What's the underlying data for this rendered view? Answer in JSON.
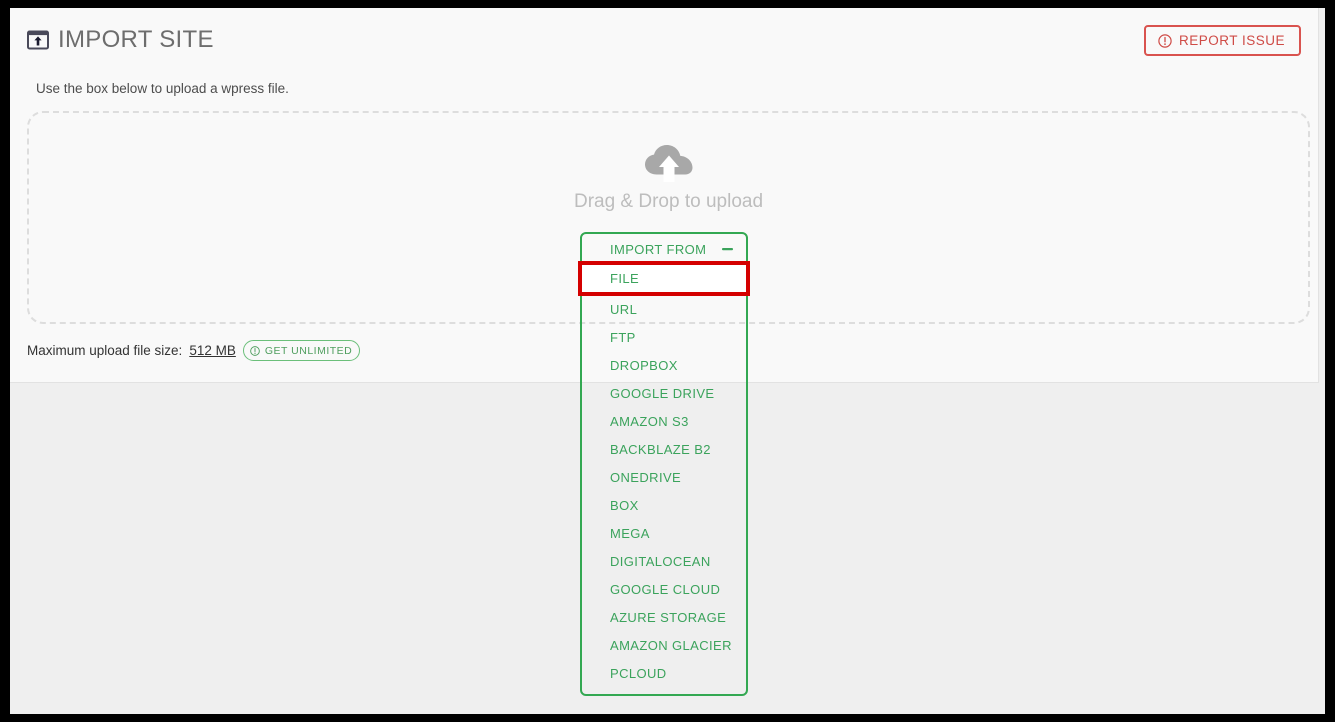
{
  "header": {
    "title": "IMPORT SITE",
    "title_icon": "import-site-icon",
    "report_issue_label": "REPORT ISSUE",
    "report_issue_icon": "exclamation-circle-icon",
    "report_issue_color": "#d9534f"
  },
  "card": {
    "subtitle": "Use the box below to upload a wpress file."
  },
  "dropzone": {
    "icon": "upload-cloud-icon",
    "label": "Drag & Drop to upload",
    "border_color": "#dddddd"
  },
  "maxsize": {
    "label": "Maximum upload file size:",
    "value": "512 MB",
    "get_unlimited_label": "GET UNLIMITED",
    "get_unlimited_icon": "exclamation-circle-icon",
    "get_unlimited_color": "#6bbf7a"
  },
  "import_menu": {
    "header_label": "IMPORT FROM",
    "collapse_icon": "minus-icon",
    "accent_color": "#33a852",
    "highlight_color": "#d40000",
    "selected": "FILE",
    "items": [
      {
        "label": "FILE"
      },
      {
        "label": "URL"
      },
      {
        "label": "FTP"
      },
      {
        "label": "DROPBOX"
      },
      {
        "label": "GOOGLE DRIVE"
      },
      {
        "label": "AMAZON S3"
      },
      {
        "label": "BACKBLAZE B2"
      },
      {
        "label": "ONEDRIVE"
      },
      {
        "label": "BOX"
      },
      {
        "label": "MEGA"
      },
      {
        "label": "DIGITALOCEAN"
      },
      {
        "label": "GOOGLE CLOUD"
      },
      {
        "label": "AZURE STORAGE"
      },
      {
        "label": "AMAZON GLACIER"
      },
      {
        "label": "PCLOUD"
      }
    ]
  }
}
